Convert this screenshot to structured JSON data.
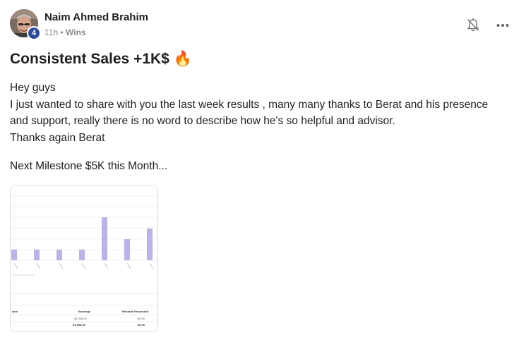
{
  "author": {
    "name": "Naim Ahmed Brahim",
    "level": "4",
    "time": "11h",
    "separator": "•",
    "category": "Wins"
  },
  "post": {
    "title": "Consistent Sales +1K$ 🔥",
    "lines": [
      "Hey guys",
      "I just wanted to share with you the last week results , many many thanks to Berat and his presence",
      "and support, really there is no word to describe how he's so helpful and advisor.",
      "Thanks again Berat"
    ],
    "milestone": "Next Milestone $5K this Month..."
  },
  "icons": {
    "bell": "bell-icon",
    "more": "more-options-icon"
  },
  "colors": {
    "badge": "#2e4a9b",
    "bar": "#b8b3e8",
    "muted": "#8a8a8a"
  },
  "attachment_chart": {
    "chart_data": {
      "type": "bar",
      "categories": [
        "1",
        "2",
        "3",
        "4",
        "5",
        "6",
        "7"
      ],
      "values": [
        0.25,
        0.25,
        0.25,
        0.25,
        1.0,
        0.49,
        0.74
      ]
    },
    "table": {
      "headers": [
        "ame",
        "Earnings",
        "Refunds Processed"
      ],
      "row": [
        "",
        "$1,058.00",
        "$0.00"
      ],
      "total": [
        "",
        "$1,058.00",
        "$0.00"
      ]
    }
  }
}
